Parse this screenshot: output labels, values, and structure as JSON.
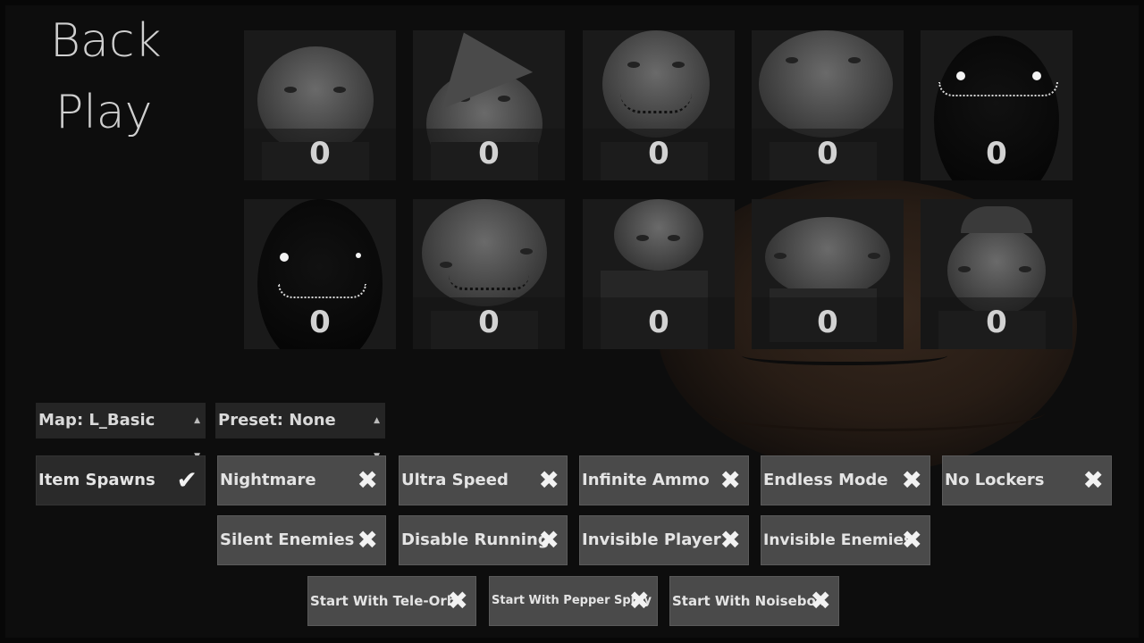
{
  "nav": {
    "back": "Back",
    "play": "Play"
  },
  "characters": [
    {
      "count": "0"
    },
    {
      "count": "0"
    },
    {
      "count": "0"
    },
    {
      "count": "0"
    },
    {
      "count": "0"
    },
    {
      "count": "0"
    },
    {
      "count": "0"
    },
    {
      "count": "0"
    },
    {
      "count": "0"
    },
    {
      "count": "0"
    }
  ],
  "map_select": {
    "label": "Map: L_Basic"
  },
  "preset_select": {
    "label": "Preset: None"
  },
  "options": {
    "item_spawns": "Item Spawns",
    "nightmare": "Nightmare",
    "ultra_speed": "Ultra Speed",
    "infinite_ammo": "Infinite Ammo",
    "endless_mode": "Endless Mode",
    "no_lockers": "No Lockers",
    "silent_enemies": "Silent Enemies",
    "disable_running": "Disable Running",
    "invisible_player": "Invisible Player",
    "invisible_enemies": "Invisible Enemies",
    "start_tele_orb": "Start With Tele-Orb",
    "start_pepper_spray": "Start With Pepper Spray",
    "start_noisebox": "Start With Noisebox"
  },
  "states": {
    "item_spawns": "✔",
    "nightmare": "✖",
    "ultra_speed": "✖",
    "infinite_ammo": "✖",
    "endless_mode": "✖",
    "no_lockers": "✖",
    "silent_enemies": "✖",
    "disable_running": "✖",
    "invisible_player": "✖",
    "invisible_enemies": "✖",
    "start_tele_orb": "✖",
    "start_pepper_spray": "✖",
    "start_noisebox": "✖"
  },
  "icons": {
    "dropdown_arrows": "▲▼",
    "checked": "check-icon",
    "unchecked": "x-icon"
  }
}
